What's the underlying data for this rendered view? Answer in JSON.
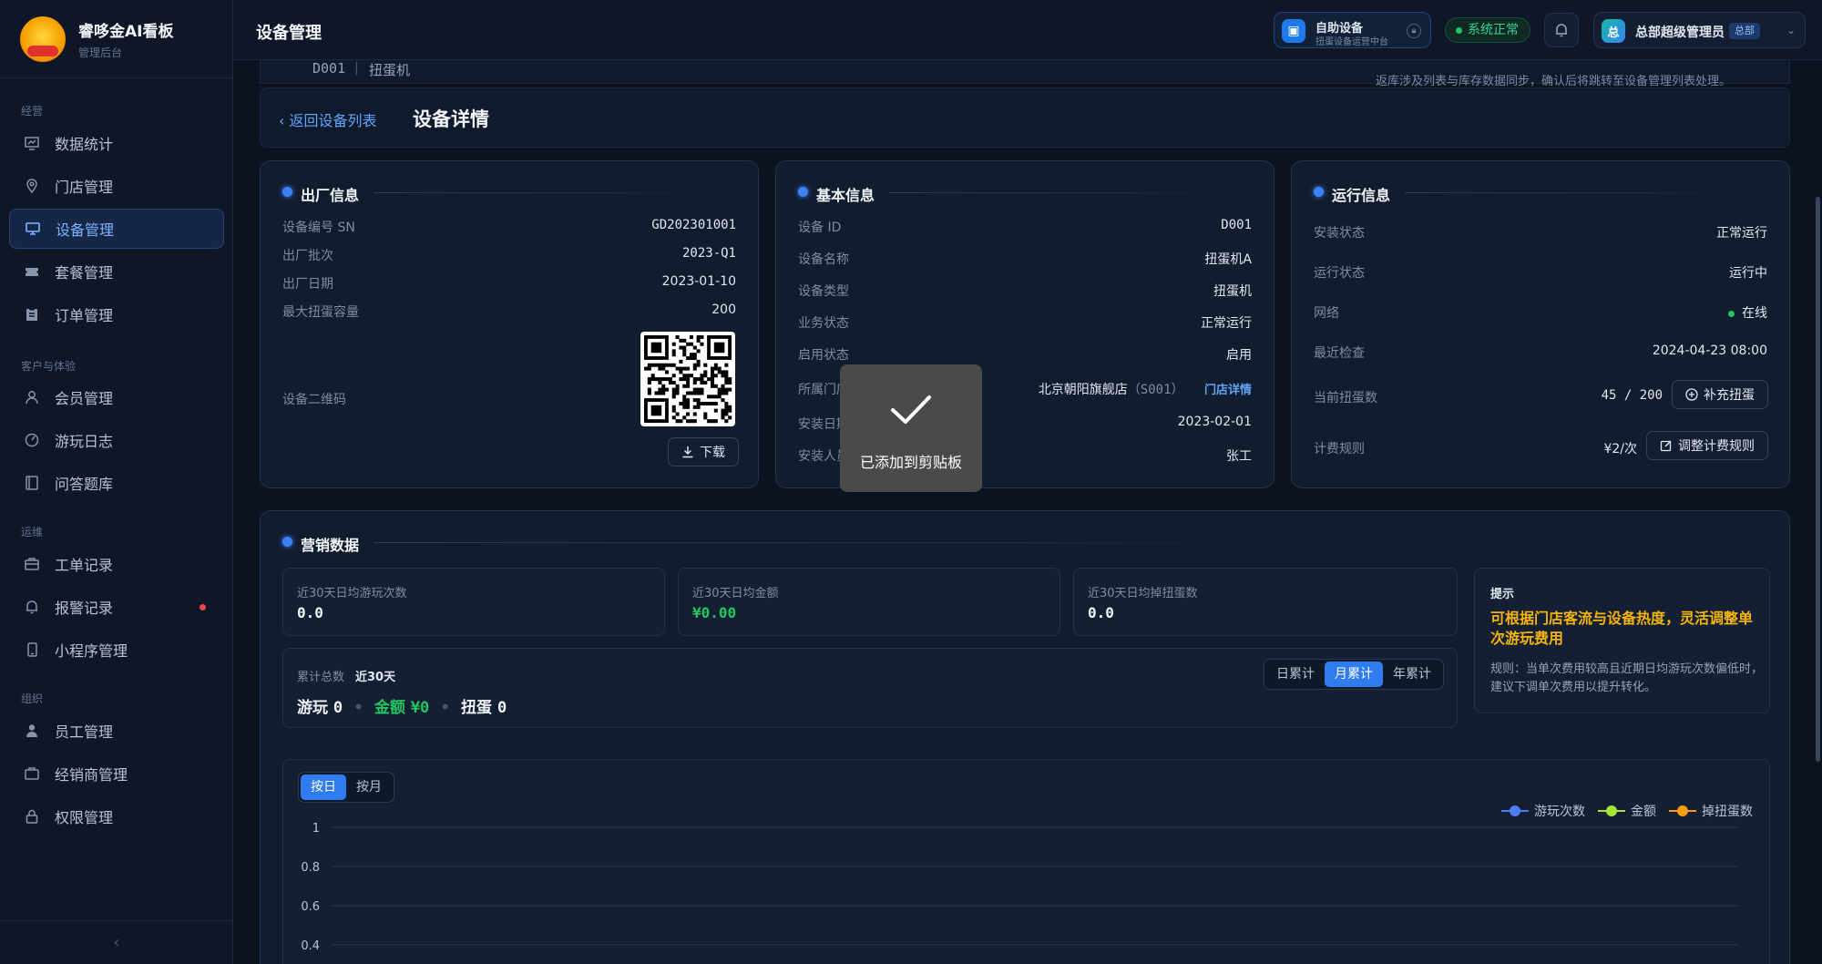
{
  "brand": {
    "title": "睿哆金AI看板",
    "subtitle": "管理后台",
    "logo_text": "睿哆金"
  },
  "sidebar": {
    "groups": [
      "经营",
      "客户与体验",
      "运维",
      "组织"
    ],
    "items": [
      {
        "label": "数据统计",
        "icon": "chart-icon"
      },
      {
        "label": "门店管理",
        "icon": "location-icon"
      },
      {
        "label": "设备管理",
        "icon": "monitor-icon",
        "active": true
      },
      {
        "label": "套餐管理",
        "icon": "ticket-icon"
      },
      {
        "label": "订单管理",
        "icon": "clipboard-icon"
      },
      {
        "label": "会员管理",
        "icon": "user-icon"
      },
      {
        "label": "游玩日志",
        "icon": "dashboard-icon"
      },
      {
        "label": "问答题库",
        "icon": "book-icon"
      },
      {
        "label": "工单记录",
        "icon": "briefcase-icon"
      },
      {
        "label": "报警记录",
        "icon": "bell-icon",
        "badge": "red-dot"
      },
      {
        "label": "小程序管理",
        "icon": "phone-icon"
      },
      {
        "label": "员工管理",
        "icon": "person-icon"
      },
      {
        "label": "经销商管理",
        "icon": "store-icon"
      },
      {
        "label": "权限管理",
        "icon": "lock-icon"
      }
    ],
    "collapse_icon": "‹"
  },
  "header": {
    "title": "设备管理",
    "device_chip": {
      "title": "自助设备",
      "subtitle": "扭蛋设备运营中台"
    },
    "status": "系统正常",
    "user": {
      "name": "总部超级管理员",
      "tag": "总部",
      "avatar": "总"
    }
  },
  "strip": {
    "device_id": "D001",
    "device_name": "扭蛋机",
    "note": "返库涉及列表与库存数据同步，确认后将跳转至设备管理列表处理。"
  },
  "page": {
    "back": "返回设备列表",
    "title": "设备详情"
  },
  "factory": {
    "title": "出厂信息",
    "rows": [
      {
        "k": "设备编号 SN",
        "v": "GD202301001"
      },
      {
        "k": "出厂批次",
        "v": "2023-Q1"
      },
      {
        "k": "出厂日期",
        "v": "2023-01-10"
      },
      {
        "k": "最大扭蛋容量",
        "v": "200"
      }
    ],
    "qr_label": "设备二维码",
    "download": "下载"
  },
  "basic": {
    "title": "基本信息",
    "rows": [
      {
        "k": "设备 ID",
        "v": "D001"
      },
      {
        "k": "设备名称",
        "v": "扭蛋机A"
      },
      {
        "k": "设备类型",
        "v": "扭蛋机"
      },
      {
        "k": "业务状态",
        "v": "正常运行"
      },
      {
        "k": "启用状态",
        "v": "启用"
      },
      {
        "k": "所属门店",
        "v": "北京朝阳旗舰店",
        "v2": "（S001）",
        "link": "门店详情"
      },
      {
        "k": "安装日期",
        "v": "2023-02-01"
      },
      {
        "k": "安装人员",
        "v": "张工"
      }
    ]
  },
  "runtime": {
    "title": "运行信息",
    "rows": [
      {
        "k": "安装状态",
        "v": "正常运行"
      },
      {
        "k": "运行状态",
        "v": "运行中"
      },
      {
        "k": "网络",
        "v": "在线"
      },
      {
        "k": "最近检查",
        "v": "2024-04-23 08:00"
      },
      {
        "k": "当前扭蛋数",
        "v": "45 / 200",
        "btn": "补充扭蛋"
      },
      {
        "k": "计费规则",
        "v": "¥2/次",
        "btn": "调整计费规则"
      }
    ]
  },
  "marketing": {
    "title": "营销数据",
    "stats": [
      {
        "label": "近30天日均游玩次数",
        "value": "0.0"
      },
      {
        "label": "近30天日均金额",
        "value": "¥0.00"
      },
      {
        "label": "近30天日均掉扭蛋数",
        "value": "0.0"
      }
    ],
    "cumulative": {
      "label": "累计总数",
      "range": "近30天",
      "play_label": "游玩",
      "play": "0",
      "amount_label": "金额",
      "amount": "¥0",
      "drop_label": "扭蛋",
      "drop": "0",
      "segments": [
        "日累计",
        "月累计",
        "年累计"
      ],
      "active_segment": "月累计"
    },
    "tip": {
      "title": "提示",
      "headline": "可根据门店客流与设备热度，灵活调整单次游玩费用",
      "rule": "规则：当单次费用较高且近期日均游玩次数偏低时，建议下调单次费用以提升转化。"
    }
  },
  "toast": {
    "text": "已添加到剪贴板"
  },
  "chart_data": {
    "type": "line",
    "toggle": [
      "按日",
      "按月"
    ],
    "active_toggle": "按日",
    "series": [
      {
        "name": "游玩次数",
        "color": "#4f7cf0",
        "values": []
      },
      {
        "name": "金额",
        "color": "#a3e635",
        "values": []
      },
      {
        "name": "掉扭蛋数",
        "color": "#f59e0b",
        "values": []
      }
    ],
    "y_ticks": [
      "1",
      "0.8",
      "0.6",
      "0.4"
    ],
    "ylim": [
      0,
      1
    ]
  },
  "colors": {
    "accent": "#2f7bf0",
    "success": "#22c55e",
    "warning": "#f5b40a"
  }
}
